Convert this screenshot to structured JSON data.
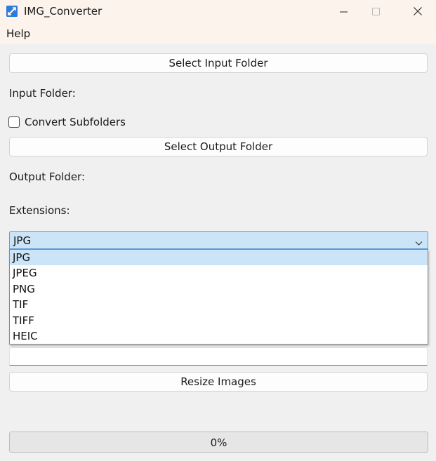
{
  "window": {
    "title": "IMG_Converter",
    "icon": "app-icon",
    "controls": {
      "minimize_icon": "minimize-icon",
      "maximize_icon": "maximize-icon",
      "close_icon": "close-icon"
    }
  },
  "menu": {
    "items": [
      {
        "label": "Help"
      }
    ]
  },
  "main": {
    "select_input_button": "Select Input Folder",
    "input_folder_label": "Input Folder:",
    "convert_subfolders_label": "Convert Subfolders",
    "convert_subfolders_checked": false,
    "select_output_button": "Select Output Folder",
    "output_folder_label": "Output Folder:",
    "extensions_label": "Extensions:",
    "extensions_combo": {
      "selected": "JPG",
      "options": [
        "JPG",
        "JPEG",
        "PNG",
        "TIF",
        "TIFF",
        "HEIC"
      ],
      "highlighted": "JPG"
    },
    "text_field_value": "",
    "resize_button": "Resize Images",
    "progress": {
      "value": 0,
      "label": "0%"
    }
  },
  "colors": {
    "titlebar_bg": "#fbf3ec",
    "window_bg": "#f0f0f0",
    "selection_bg": "#cce4f7",
    "combo_border": "#5f9edb",
    "progress_fill": "#06b025"
  }
}
